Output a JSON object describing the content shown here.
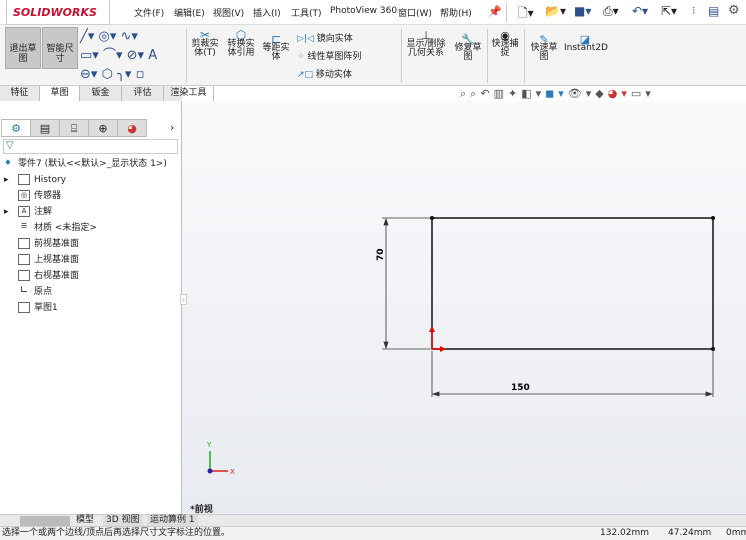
{
  "app": {
    "logo": "SOLIDWORKS",
    "brand_color": "#c8102e"
  },
  "menu": [
    "文件(F)",
    "编辑(E)",
    "视图(V)",
    "插入(I)",
    "工具(T)",
    "PhotoView 360",
    "窗口(W)",
    "帮助(H)"
  ],
  "quick_icons": [
    "new-doc-icon",
    "open-icon",
    "save-icon",
    "print-icon",
    "undo-icon",
    "select-icon",
    "traffic-light-icon",
    "options-list-icon",
    "gear-icon"
  ],
  "ribbon": {
    "exit_sketch": "退出草图",
    "smart_dim": "智能尺寸",
    "trim": "剪裁实体(T)",
    "convert": "转换实体引用",
    "offset": "等距实体",
    "mirror": "镜向实体",
    "linear_pattern": "线性草图阵列",
    "move": "移动实体",
    "show_delete": "显示/删除几何关系",
    "repair": "修复草图",
    "quick_snap": "快速捕捉",
    "rapid_sketch": "快速草图",
    "instant2d": "Instant2D"
  },
  "tabs": [
    "特征",
    "草图",
    "钣金",
    "评估",
    "渲染工具"
  ],
  "active_tab": 1,
  "tree": {
    "root": "零件7 (默认<<默认>_显示状态 1>)",
    "items": [
      "History",
      "传感器",
      "注解",
      "材质 <未指定>",
      "前视基准面",
      "上视基准面",
      "右视基准面",
      "原点",
      "草图1"
    ]
  },
  "sketch": {
    "width_dim": "150",
    "height_dim": "70",
    "view_label": "*前视"
  },
  "bottom_tabs": [
    "模型",
    "3D 视图",
    "运动算例 1"
  ],
  "status": {
    "message": "选择一个或两个边线/顶点后再选择尺寸文字标注的位置。",
    "x": "132.02mm",
    "y": "47.24mm",
    "z": "0mm"
  }
}
